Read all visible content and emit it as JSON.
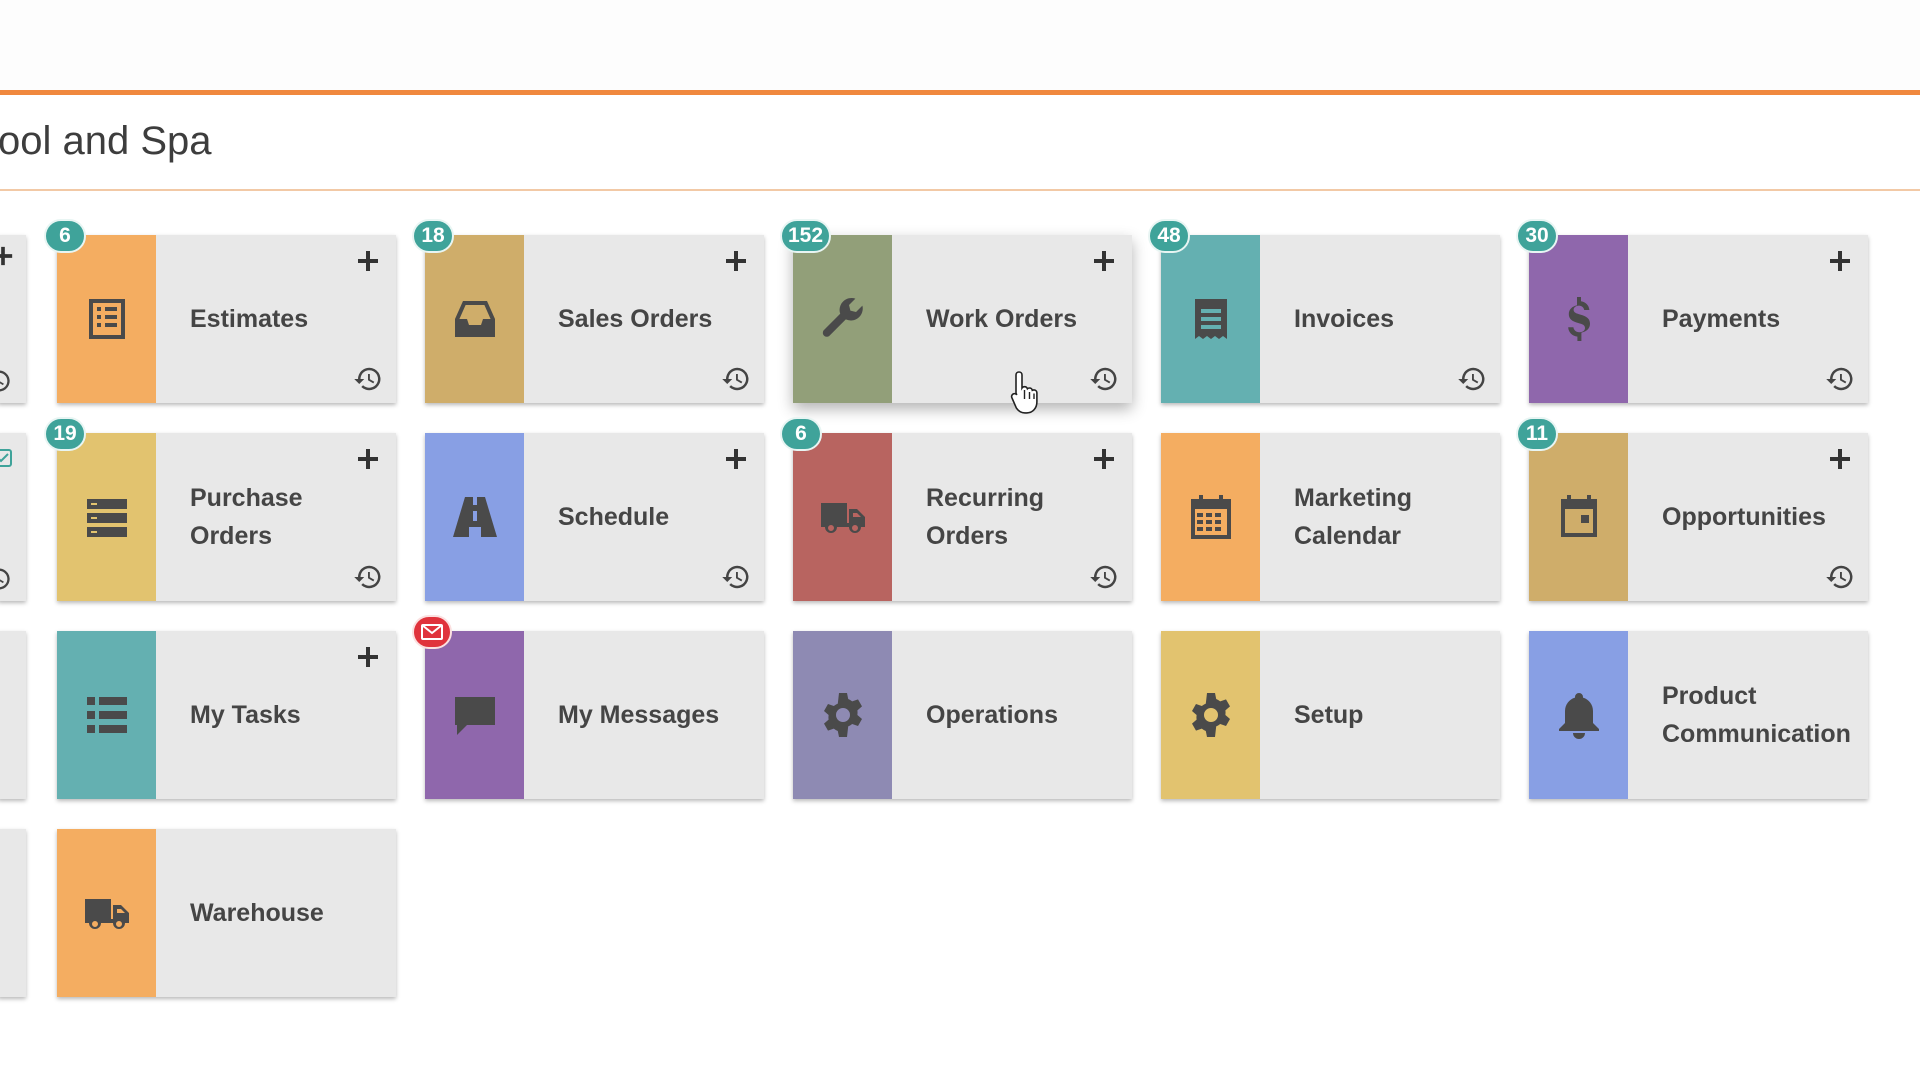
{
  "page": {
    "title": "ool and Spa"
  },
  "colors": {
    "accent": "#f0883e",
    "badge": "#3fa39a",
    "mail_badge": "#e0333c"
  },
  "tiles": {
    "estimates": {
      "label": "Estimates",
      "badge": "6",
      "icon": "list-icon",
      "color": "#f4ad61"
    },
    "sales_orders": {
      "label": "Sales Orders",
      "badge": "18",
      "icon": "inbox-icon",
      "color": "#cfad6a"
    },
    "work_orders": {
      "label": "Work Orders",
      "badge": "152",
      "icon": "wrench-icon",
      "color": "#929f79"
    },
    "invoices": {
      "label": "Invoices",
      "badge": "48",
      "icon": "document-icon",
      "color": "#64b0b1"
    },
    "payments": {
      "label": "Payments",
      "badge": "30",
      "icon": "dollar-icon",
      "color": "#8f67ac"
    },
    "purchase_orders": {
      "label": "Purchase Orders",
      "badge": "19",
      "icon": "stack-icon",
      "color": "#e2c36f"
    },
    "schedule": {
      "label": "Schedule",
      "icon": "road-icon",
      "color": "#889fe4"
    },
    "recurring_orders": {
      "label": "Recurring Orders",
      "badge": "6",
      "icon": "truck-icon",
      "color": "#b86460"
    },
    "marketing_calendar": {
      "label": "Marketing Calendar",
      "icon": "calendar-icon",
      "color": "#f4ad61"
    },
    "opportunities": {
      "label": "Opportunities",
      "badge": "11",
      "icon": "calendar-day-icon",
      "color": "#cfad6a"
    },
    "my_tasks": {
      "label": "My Tasks",
      "icon": "bullet-list-icon",
      "color": "#64b0b1"
    },
    "my_messages": {
      "label": "My Messages",
      "icon": "chat-icon",
      "color": "#8f67ac"
    },
    "operations": {
      "label": "Operations",
      "icon": "gear-icon",
      "color": "#8e8ab3"
    },
    "setup": {
      "label": "Setup",
      "icon": "gear-icon",
      "color": "#e2c36f"
    },
    "product_communication": {
      "label": "Product Communication",
      "icon": "bell-icon",
      "color": "#889fe4"
    },
    "warehouse": {
      "label": "Warehouse",
      "icon": "truck-icon",
      "color": "#f4ad61"
    }
  }
}
